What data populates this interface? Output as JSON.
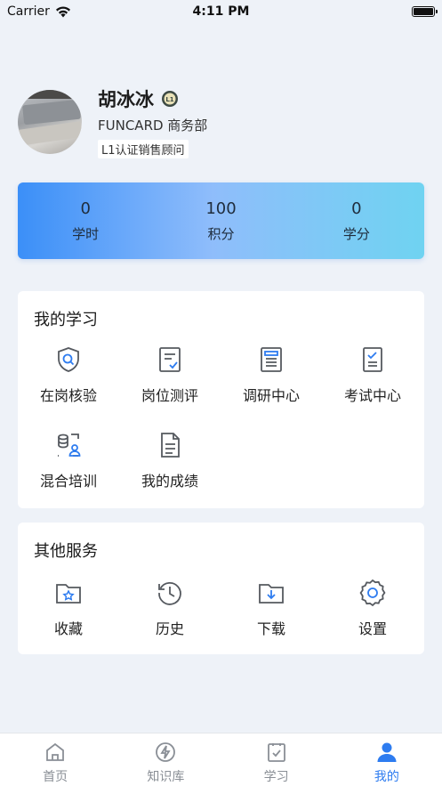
{
  "status_bar": {
    "carrier": "Carrier",
    "time": "4:11 PM"
  },
  "profile": {
    "name": "胡冰冰",
    "department": "FUNCARD 商务部",
    "level": "L1认证销售顾问",
    "badge_icon": "l1-badge-icon"
  },
  "stats": [
    {
      "value": "0",
      "label": "学时"
    },
    {
      "value": "100",
      "label": "积分"
    },
    {
      "value": "0",
      "label": "学分"
    }
  ],
  "my_learning": {
    "title": "我的学习",
    "items": [
      {
        "label": "在岗核验",
        "icon": "shield-search-icon"
      },
      {
        "label": "岗位测评",
        "icon": "checklist-icon"
      },
      {
        "label": "调研中心",
        "icon": "survey-icon"
      },
      {
        "label": "考试中心",
        "icon": "exam-icon"
      },
      {
        "label": "混合培训",
        "icon": "mixed-training-icon"
      },
      {
        "label": "我的成绩",
        "icon": "document-icon"
      }
    ]
  },
  "other_services": {
    "title": "其他服务",
    "items": [
      {
        "label": "收藏",
        "icon": "favorite-folder-icon"
      },
      {
        "label": "历史",
        "icon": "history-icon"
      },
      {
        "label": "下载",
        "icon": "download-folder-icon"
      },
      {
        "label": "设置",
        "icon": "gear-icon"
      }
    ]
  },
  "tabbar": {
    "tabs": [
      {
        "label": "首页",
        "icon": "home-icon"
      },
      {
        "label": "知识库",
        "icon": "lightning-icon"
      },
      {
        "label": "学习",
        "icon": "study-icon"
      },
      {
        "label": "我的",
        "icon": "user-icon",
        "active": true
      }
    ]
  },
  "colors": {
    "accent": "#2e7cf0",
    "icon_gray": "#55595f",
    "icon_blue": "#2e7cf0"
  }
}
